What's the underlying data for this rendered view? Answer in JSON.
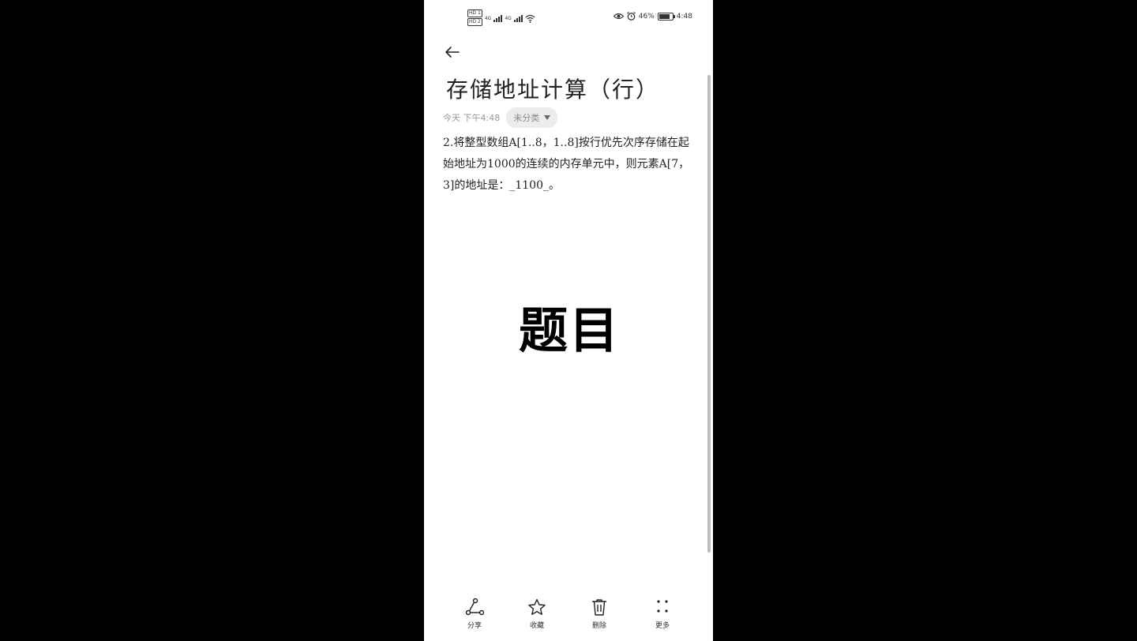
{
  "status_bar": {
    "sim1": "HD 1",
    "sim2": "HD 2",
    "network1": "4G",
    "network2": "4G",
    "battery_percent": "46%",
    "time": "4:48"
  },
  "note": {
    "title": "存储地址计算（行）",
    "date": "今天 下午4:48",
    "category": "未分类",
    "body": "2.将整型数组A[1..8，1..8]按行优先次序存储在起始地址为1000的连续的内存单元中，则元素A[7，3]的地址是：_1100_。"
  },
  "overlay_caption": "题目",
  "bottom_bar": {
    "share": "分享",
    "favorite": "收藏",
    "delete": "删除",
    "more": "更多"
  }
}
